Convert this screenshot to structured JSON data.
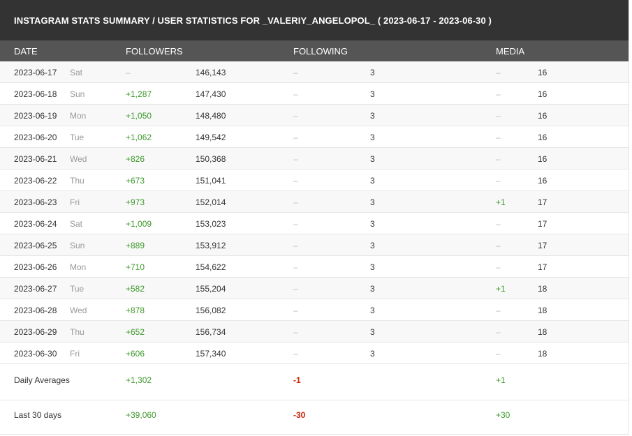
{
  "title": "INSTAGRAM STATS SUMMARY / USER STATISTICS FOR _VALERIY_ANGELOPOL_ ( 2023-06-17 - 2023-06-30 )",
  "columns": {
    "date": "DATE",
    "followers": "FOLLOWERS",
    "following": "FOLLOWING",
    "media": "MEDIA"
  },
  "rows": [
    {
      "date": "2023-06-17",
      "day": "Sat",
      "followers_change": "–",
      "followers_total": "146,143",
      "following_change": "–",
      "following_total": "3",
      "media_change": "–",
      "media_total": "16"
    },
    {
      "date": "2023-06-18",
      "day": "Sun",
      "followers_change": "+1,287",
      "followers_total": "147,430",
      "following_change": "–",
      "following_total": "3",
      "media_change": "–",
      "media_total": "16"
    },
    {
      "date": "2023-06-19",
      "day": "Mon",
      "followers_change": "+1,050",
      "followers_total": "148,480",
      "following_change": "–",
      "following_total": "3",
      "media_change": "–",
      "media_total": "16"
    },
    {
      "date": "2023-06-20",
      "day": "Tue",
      "followers_change": "+1,062",
      "followers_total": "149,542",
      "following_change": "–",
      "following_total": "3",
      "media_change": "–",
      "media_total": "16"
    },
    {
      "date": "2023-06-21",
      "day": "Wed",
      "followers_change": "+826",
      "followers_total": "150,368",
      "following_change": "–",
      "following_total": "3",
      "media_change": "–",
      "media_total": "16"
    },
    {
      "date": "2023-06-22",
      "day": "Thu",
      "followers_change": "+673",
      "followers_total": "151,041",
      "following_change": "–",
      "following_total": "3",
      "media_change": "–",
      "media_total": "16"
    },
    {
      "date": "2023-06-23",
      "day": "Fri",
      "followers_change": "+973",
      "followers_total": "152,014",
      "following_change": "–",
      "following_total": "3",
      "media_change": "+1",
      "media_total": "17"
    },
    {
      "date": "2023-06-24",
      "day": "Sat",
      "followers_change": "+1,009",
      "followers_total": "153,023",
      "following_change": "–",
      "following_total": "3",
      "media_change": "–",
      "media_total": "17"
    },
    {
      "date": "2023-06-25",
      "day": "Sun",
      "followers_change": "+889",
      "followers_total": "153,912",
      "following_change": "–",
      "following_total": "3",
      "media_change": "–",
      "media_total": "17"
    },
    {
      "date": "2023-06-26",
      "day": "Mon",
      "followers_change": "+710",
      "followers_total": "154,622",
      "following_change": "–",
      "following_total": "3",
      "media_change": "–",
      "media_total": "17"
    },
    {
      "date": "2023-06-27",
      "day": "Tue",
      "followers_change": "+582",
      "followers_total": "155,204",
      "following_change": "–",
      "following_total": "3",
      "media_change": "+1",
      "media_total": "18"
    },
    {
      "date": "2023-06-28",
      "day": "Wed",
      "followers_change": "+878",
      "followers_total": "156,082",
      "following_change": "–",
      "following_total": "3",
      "media_change": "–",
      "media_total": "18"
    },
    {
      "date": "2023-06-29",
      "day": "Thu",
      "followers_change": "+652",
      "followers_total": "156,734",
      "following_change": "–",
      "following_total": "3",
      "media_change": "–",
      "media_total": "18"
    },
    {
      "date": "2023-06-30",
      "day": "Fri",
      "followers_change": "+606",
      "followers_total": "157,340",
      "following_change": "–",
      "following_total": "3",
      "media_change": "–",
      "media_total": "18"
    }
  ],
  "summary": [
    {
      "label": "Daily Averages",
      "followers": "+1,302",
      "following": "-1",
      "media": "+1"
    },
    {
      "label": "Last 30 days",
      "followers": "+39,060",
      "following": "-30",
      "media": "+30"
    }
  ],
  "colors": {
    "title_bg": "#333333",
    "header_bg": "#555555",
    "positive": "#3f9a2e",
    "negative": "#cc2200"
  }
}
